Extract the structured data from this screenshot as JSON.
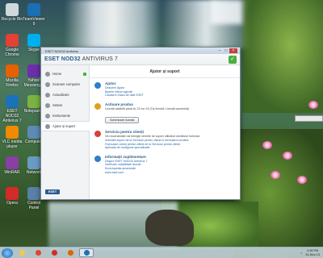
{
  "desktop_icons": [
    {
      "label": "Recycle Bin",
      "color": "#cfd8dc"
    },
    {
      "label": "Google Chrome",
      "color": "#e34133"
    },
    {
      "label": "Mozilla Firefox",
      "color": "#e66000"
    },
    {
      "label": "ESET NOD32 Antivirus 7",
      "color": "#1a73b8"
    },
    {
      "label": "VLC media player",
      "color": "#f08a00"
    },
    {
      "label": "WinRAR",
      "color": "#8a3fa6"
    },
    {
      "label": "Opera",
      "color": "#d42a2a"
    },
    {
      "label": "TeamViewer 9",
      "color": "#1a6fb5"
    },
    {
      "label": "Skype",
      "color": "#00aff0"
    },
    {
      "label": "Yahoo! Messenger",
      "color": "#6d2eab"
    },
    {
      "label": "Notepad++",
      "color": "#7cb342"
    },
    {
      "label": "Computer",
      "color": "#5e8bb5"
    },
    {
      "label": "Network",
      "color": "#6a9bc5"
    },
    {
      "label": "Control Panel",
      "color": "#5a7fa8"
    }
  ],
  "window": {
    "title": "ESET NOD32 Antivirus",
    "brand": "ESET NOD32",
    "brand_suffix": "ANTIVIRUS 7",
    "status_icon": "check-icon",
    "minimize": "–",
    "maximize": "□",
    "close": "×"
  },
  "sidebar": {
    "items": [
      {
        "label": "Home",
        "icon": "home-icon"
      },
      {
        "label": "Scanare computer",
        "icon": "scan-icon"
      },
      {
        "label": "Actualizare",
        "icon": "update-icon"
      },
      {
        "label": "Setare",
        "icon": "setup-icon"
      },
      {
        "label": "Instrumente",
        "icon": "tools-icon"
      },
      {
        "label": "Ajutor și suport",
        "icon": "help-icon"
      }
    ],
    "logo": "ESET"
  },
  "main": {
    "title": "Ajutor și suport",
    "sections": [
      {
        "title": "Ajutor",
        "icon": "question-icon",
        "lines": [
          "Descrieri Ajutor",
          "Bazele infelor agentă",
          "Căutați în Baza de date ESET"
        ],
        "color": "#2e7fc7"
      },
      {
        "title": "Activare produs",
        "icon": "key-icon",
        "lines_plain": [
          "Licență valabilă până la: 22 Iun 15 (Tip licență: Licență comercial)"
        ],
        "button": "Schimbare licență",
        "color": "#e0a020"
      },
      {
        "title": "Serviciu pentru clienți",
        "icon": "lifebuoy-icon",
        "lines_plain": [
          "Vă recomandăm să întregiți cererile de suport utilizând următorul formular."
        ],
        "lines": [
          "Solicitări suport de la Serviciul pentru clienți în formularul următor",
          "Formulare online pentru clienți de la Serviciul pentru clienți",
          "Aplicația de configurat specializată"
        ],
        "color": "#d94040"
      },
      {
        "title": "Informații suplimentare",
        "icon": "info-icon",
        "lines": [
          "Despre ESET NOD32 Antivirus 7",
          "Verificare valabilitate licență",
          "Enciclopedia amenințări",
          "www.eset.com"
        ],
        "color": "#2e7fc7"
      }
    ]
  },
  "taskbar": {
    "apps": [
      {
        "name": "explorer",
        "color": "#f2c94c"
      },
      {
        "name": "chrome",
        "color": "#e34133"
      },
      {
        "name": "opera",
        "color": "#d42a2a"
      },
      {
        "name": "firefox",
        "color": "#e66000"
      },
      {
        "name": "eset",
        "color": "#1a73b8"
      }
    ],
    "time": "4:38 PM",
    "date": "24-Nov-13"
  }
}
